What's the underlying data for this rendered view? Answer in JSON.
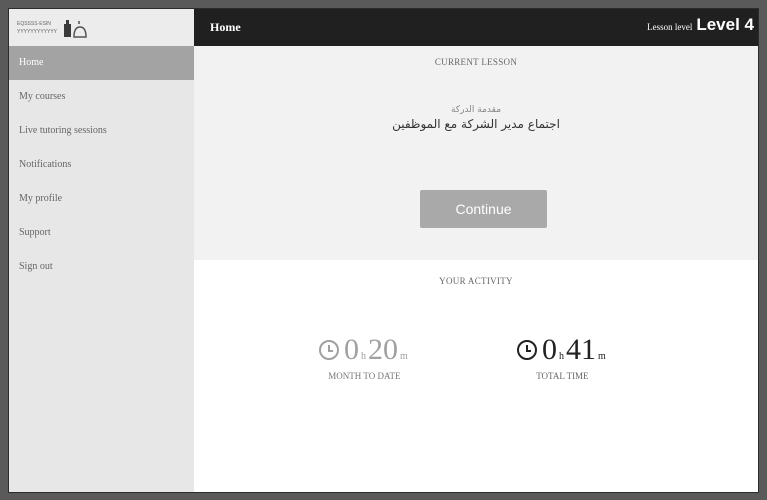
{
  "sidebar": {
    "logo": {
      "line1": "EQSSSS·ESIN",
      "line2": "YYYYYYYYYYYY"
    },
    "items": [
      {
        "label": "Home",
        "active": true
      },
      {
        "label": "My courses",
        "active": false
      },
      {
        "label": "Live tutoring sessions",
        "active": false
      },
      {
        "label": "Notifications",
        "active": false
      },
      {
        "label": "My profile",
        "active": false
      },
      {
        "label": "Support",
        "active": false
      },
      {
        "label": "Sign out",
        "active": false
      }
    ]
  },
  "header": {
    "title": "Home",
    "level_label": "Lesson level",
    "level_value": "Level 4"
  },
  "current_lesson": {
    "heading": "CURRENT LESSON",
    "subtitle": "مقدمة الدركة",
    "title": "اجتماع مدير الشركة مع الموظفين",
    "button_label": "Continue"
  },
  "activity": {
    "heading": "YOUR ACTIVITY",
    "month": {
      "hours": "0",
      "hours_unit": "h",
      "minutes": "20",
      "minutes_unit": "m",
      "label": "MONTH TO DATE"
    },
    "total": {
      "hours": "0",
      "hours_unit": "h",
      "minutes": "41",
      "minutes_unit": "m",
      "label": "TOTAL TIME"
    }
  },
  "colors": {
    "header_bg": "#202020",
    "sidebar_bg": "#e7e7e7",
    "active_item_bg": "#a3a3a3",
    "button_bg": "#a9a9a9"
  }
}
